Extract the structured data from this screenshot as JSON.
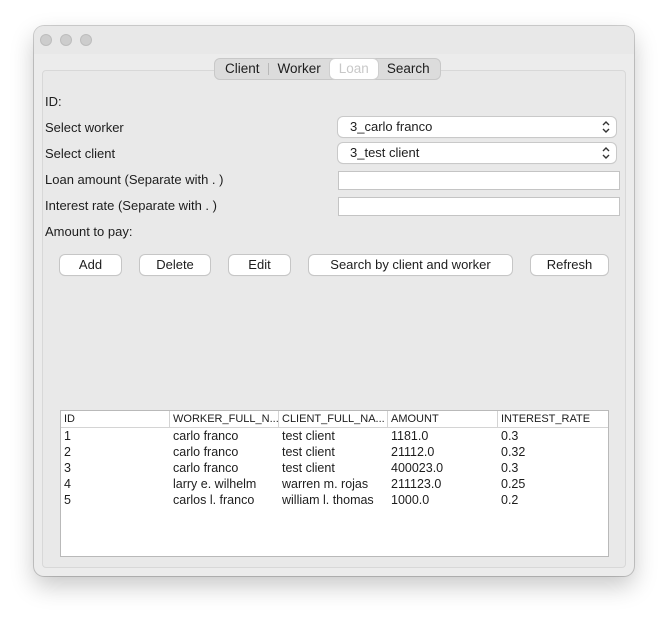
{
  "tabs": [
    {
      "label": "Client"
    },
    {
      "label": "Worker"
    },
    {
      "label": "Loan",
      "active": true
    },
    {
      "label": "Search"
    }
  ],
  "form": {
    "id_label": "ID:",
    "id_value": "",
    "worker_label": "Select worker",
    "worker_value": "3_carlo franco",
    "client_label": "Select client",
    "client_value": "3_test client",
    "amount_label": "Loan amount (Separate with . )",
    "amount_value": "",
    "rate_label": "Interest rate (Separate with . )",
    "rate_value": "",
    "pay_label": "Amount to pay:",
    "pay_value": ""
  },
  "buttons": {
    "add": "Add",
    "delete": "Delete",
    "edit": "Edit",
    "search": "Search by client and worker",
    "refresh": "Refresh"
  },
  "table": {
    "headers": [
      "ID",
      "WORKER_FULL_N...",
      "CLIENT_FULL_NA...",
      "AMOUNT",
      "INTEREST_RATE"
    ],
    "rows": [
      [
        "1",
        "carlo franco",
        "test client",
        "1181.0",
        "0.3"
      ],
      [
        "2",
        "carlo franco",
        "test client",
        "21112.0",
        "0.32"
      ],
      [
        "3",
        "carlo franco",
        "test client",
        "400023.0",
        "0.3"
      ],
      [
        "4",
        "larry e. wilhelm",
        "warren m. rojas",
        "211123.0",
        "0.25"
      ],
      [
        "5",
        "carlos l. franco",
        "william l. thomas",
        "1000.0",
        "0.2"
      ]
    ]
  }
}
